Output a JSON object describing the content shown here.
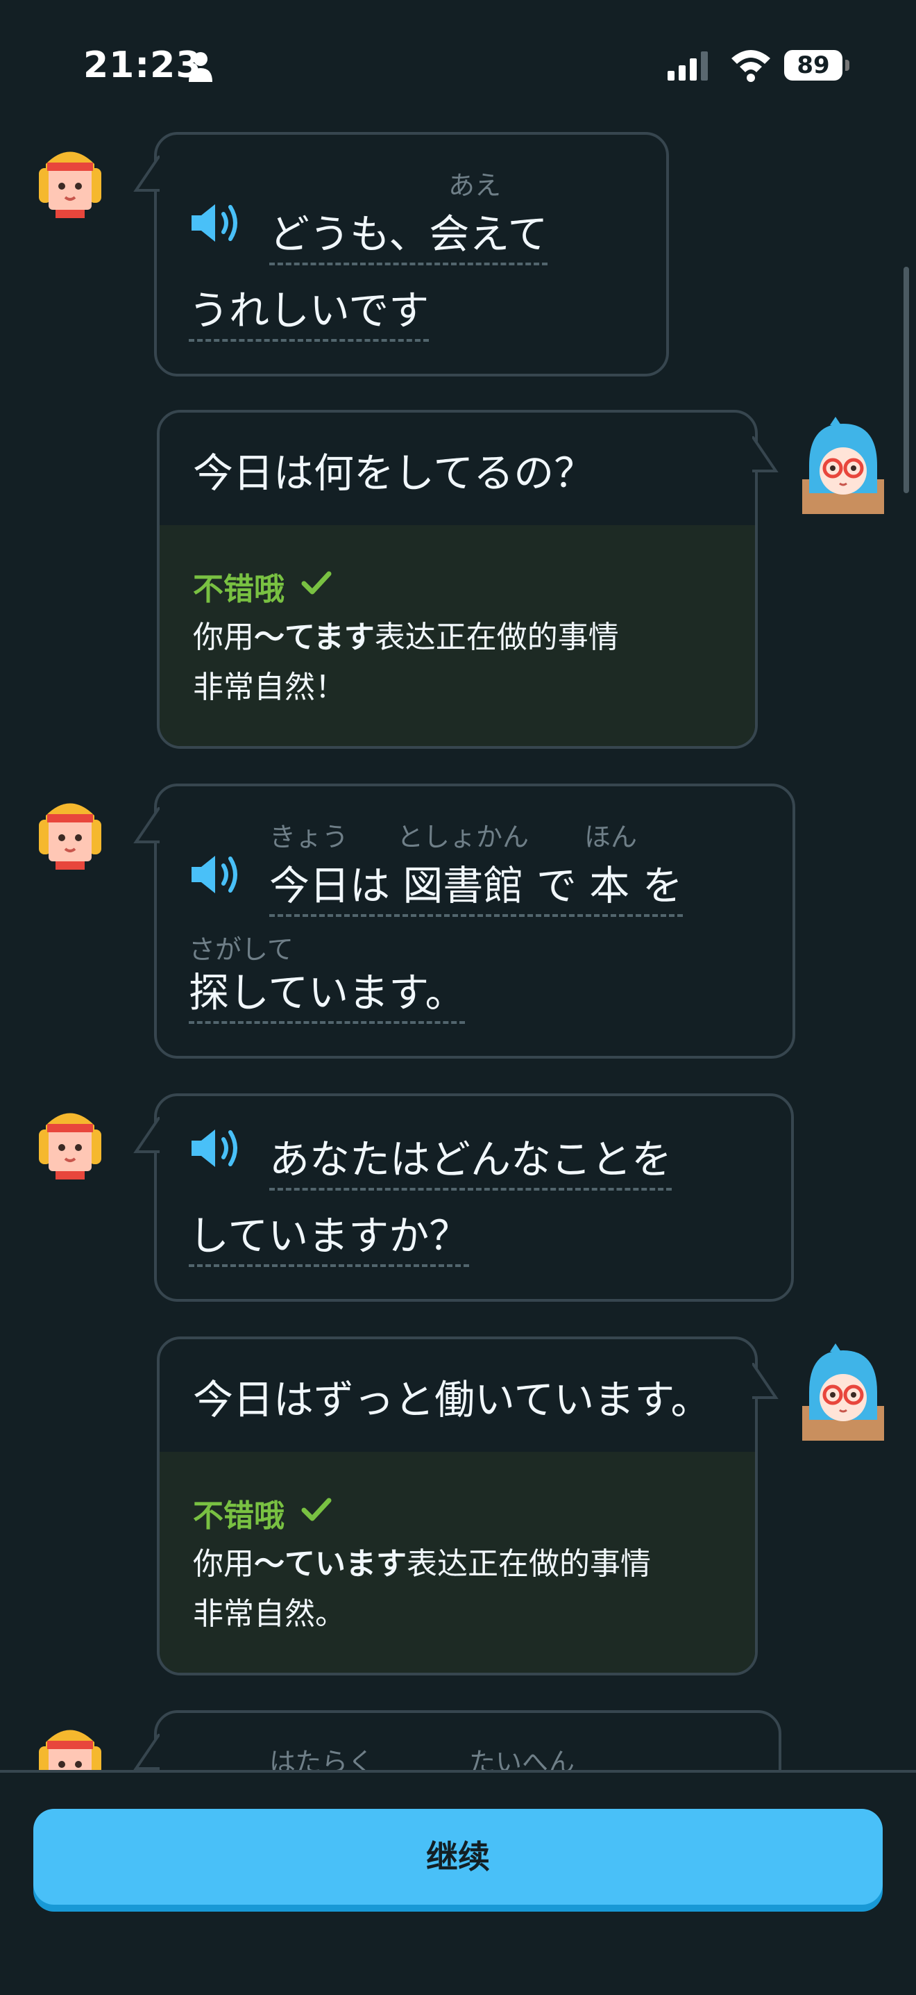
{
  "status_bar": {
    "time": "21:23",
    "battery": "89"
  },
  "messages": [
    {
      "speaker": "character",
      "ruby_1": "あえ",
      "line_1": "どうも、会えて",
      "line_2": "うれしいです"
    },
    {
      "speaker": "user",
      "text": "今日は何をしてるの？",
      "feedback_title": "不错哦",
      "feedback_pre": "你用",
      "feedback_bold": "〜てます",
      "feedback_post": "表达正在做的事情",
      "feedback_line2": "非常自然！"
    },
    {
      "speaker": "character",
      "ruby_1": "きょう",
      "ruby_2": "としょかん",
      "ruby_3": "ほん",
      "line_1": "今日は 図書館 で 本 を",
      "ruby_4": "さがして",
      "line_2": "探しています。"
    },
    {
      "speaker": "character",
      "line_1": "あなたはどんなことを",
      "line_2": "していますか？"
    },
    {
      "speaker": "user",
      "text": "今日はずっと働いています。",
      "feedback_title": "不错哦",
      "feedback_pre": "你用",
      "feedback_bold": "〜ています",
      "feedback_post": "表达正在做的事情",
      "feedback_line2": "非常自然。"
    },
    {
      "speaker": "character",
      "ruby_1": "はたらく",
      "ruby_2": "たいへん"
    }
  ],
  "footer": {
    "continue_label": "继续"
  },
  "colors": {
    "background": "#131f24",
    "bubble_border": "#37464f",
    "accent": "#49c0f8",
    "success": "#79c142"
  }
}
